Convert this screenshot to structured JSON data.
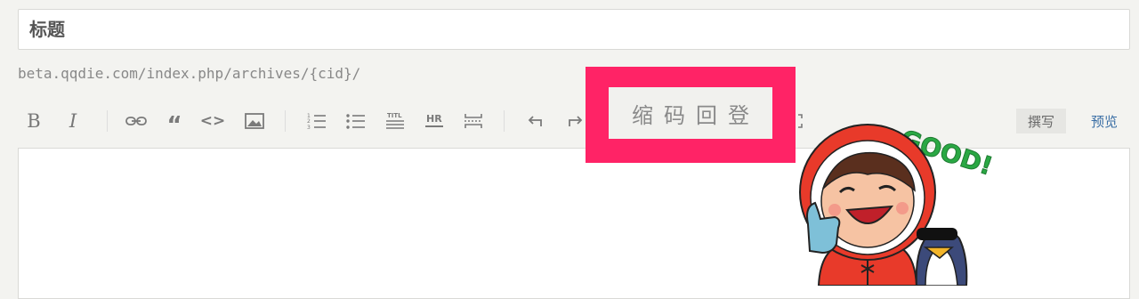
{
  "title_field": {
    "placeholder": "标题"
  },
  "permalink": "beta.qqdie.com/index.php/archives/{cid}/",
  "toolbar": {
    "bold": "B",
    "italic": "I",
    "quote": "“",
    "code": "<>",
    "callout_text": "缩码回登",
    "write_label": "撰写",
    "preview_label": "预览",
    "icons": [
      "bold-icon",
      "italic-icon",
      "link-icon",
      "quote-icon",
      "code-icon",
      "image-icon",
      "ordered-list-icon",
      "unordered-list-icon",
      "title-icon",
      "hr-icon",
      "more-icon",
      "undo-icon",
      "redo-icon"
    ]
  },
  "sticker": {
    "text": "GOOD!"
  },
  "colors": {
    "accent": "#ff2366",
    "preview_link": "#3a6ea5",
    "sticker_red": "#e83a2a",
    "sticker_green": "#2aa844"
  }
}
